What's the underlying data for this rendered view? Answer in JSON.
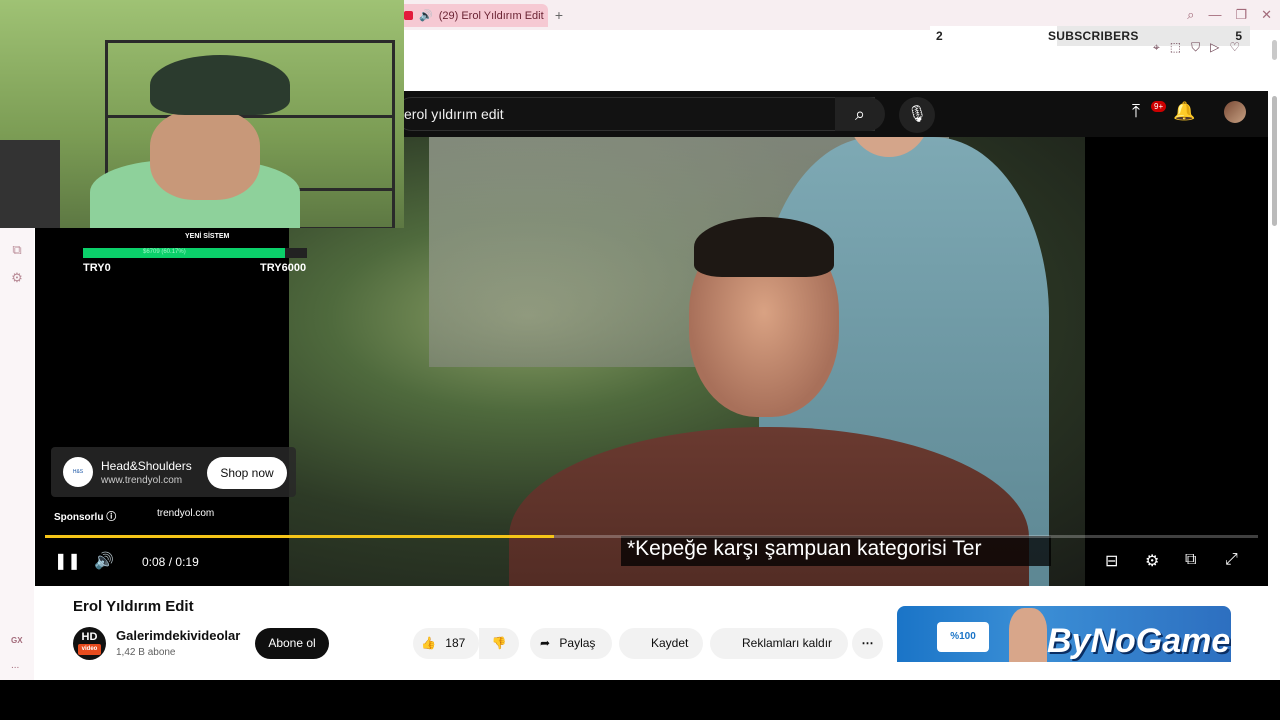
{
  "browser": {
    "tab_title": "(29) Erol Yıldırım Edit",
    "new_tab_symbol": "+"
  },
  "subscriber_widget": {
    "left_value": "2",
    "label": "SUBSCRIBERS",
    "right_value": "5",
    "progress_fraction": 0.6
  },
  "youtube_header": {
    "search_query": "erol yıldırım edit",
    "notification_count": "9+"
  },
  "ad_overlay": {
    "sponsor_title": "YENİ SİSTEM",
    "sponsor_progress_text": "$6709 (60.17%)",
    "range_start": "TRY0",
    "range_end": "TRY6000",
    "advertiser_name": "Head&Shoulders",
    "advertiser_url": "www.trendyol.com",
    "shop_button": "Shop now",
    "sponsored_label": "Sponsorlu",
    "sponsored_domain": "trendyol.com"
  },
  "player": {
    "subtitle": "*Kepeğe karşı şampuan kategorisi Ter",
    "time_current": "0:08",
    "time_separator": "/",
    "time_total": "0:19",
    "progress_fraction": 0.42
  },
  "video_info": {
    "title": "Erol Yıldırım Edit",
    "channel_name": "Galerimdekivideolar",
    "channel_subs": "1,42 B abone",
    "channel_avatar_top": "HD",
    "channel_avatar_bottom": "video",
    "subscribe_button": "Abone ol",
    "like_count": "187",
    "share_label": "Paylaş",
    "save_label": "Kaydet",
    "remove_ads_label": "Reklamları kaldır"
  },
  "recommendation": {
    "brand_text": "ByNoGame",
    "badge_text": "%100"
  },
  "sidebar": {
    "gx_label": "GX",
    "more_dots": "..."
  },
  "colors": {
    "progress": "#f5c518",
    "sponsor_fill": "#0bd06a",
    "header_bg": "#0f0f0f",
    "tab_bg": "#f6c9d3"
  }
}
